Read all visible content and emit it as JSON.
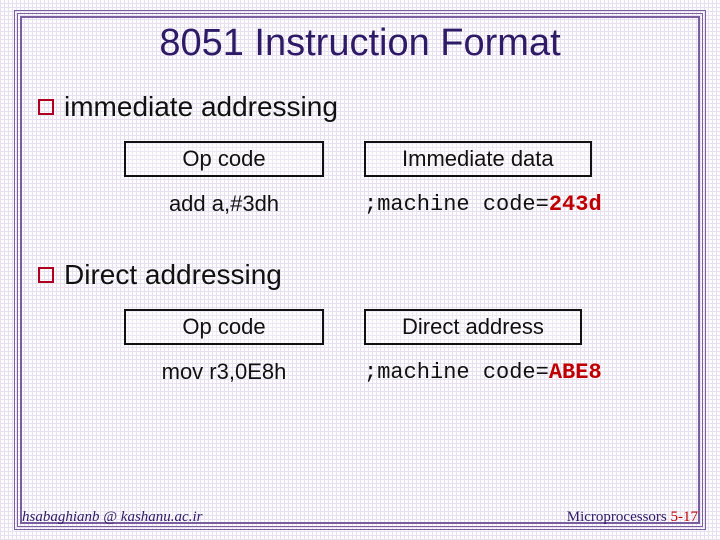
{
  "title": "8051 Instruction Format",
  "sections": [
    {
      "heading": "immediate addressing",
      "box1": "Op code",
      "box2": "Immediate data",
      "asm": "add a,#3dh",
      "code_prefix": ";machine code=",
      "code_hex": "243d"
    },
    {
      "heading": "Direct addressing",
      "box1": "Op code",
      "box2": "Direct address",
      "asm": "mov r3,0E8h",
      "code_prefix": ";machine code=",
      "code_hex": "ABE8"
    }
  ],
  "footer": {
    "left": "hsabaghianb @ kashanu.ac.ir",
    "right_label": "Microprocessors",
    "right_page": "5-17"
  }
}
